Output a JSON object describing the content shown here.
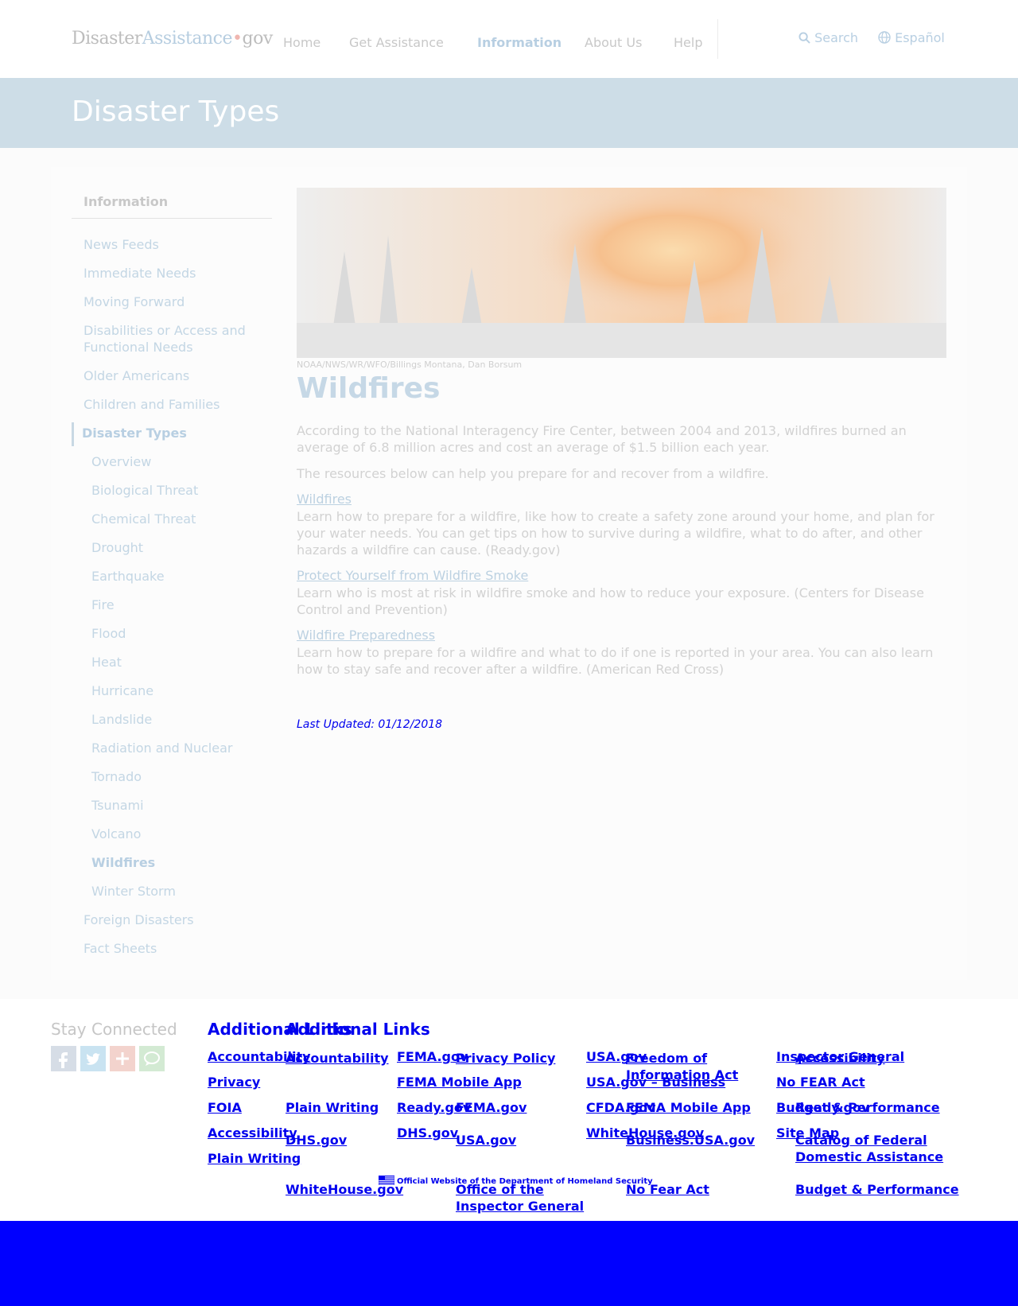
{
  "header": {
    "logo": {
      "part1": "Disaster",
      "part2": "Assistance",
      "dot": "•",
      "part3": "gov"
    },
    "nav": [
      {
        "label": "Home"
      },
      {
        "label": "Get Assistance"
      },
      {
        "label": "Information"
      },
      {
        "label": "About Us"
      },
      {
        "label": "Help"
      }
    ],
    "search_label": "Search",
    "language_label": "Español"
  },
  "banner": {
    "title": "Disaster Types"
  },
  "sidebar": {
    "heading": "Information",
    "items": [
      {
        "label": "News Feeds"
      },
      {
        "label": "Immediate Needs"
      },
      {
        "label": "Moving Forward"
      },
      {
        "label": "Disabilities or Access and Functional Needs"
      },
      {
        "label": "Older Americans"
      },
      {
        "label": "Children and Families"
      },
      {
        "label": "Disaster Types"
      }
    ],
    "subitems": [
      {
        "label": "Overview"
      },
      {
        "label": "Biological Threat"
      },
      {
        "label": "Chemical Threat"
      },
      {
        "label": "Drought"
      },
      {
        "label": "Earthquake"
      },
      {
        "label": "Fire"
      },
      {
        "label": "Flood"
      },
      {
        "label": "Heat"
      },
      {
        "label": "Hurricane"
      },
      {
        "label": "Landslide"
      },
      {
        "label": "Radiation and Nuclear"
      },
      {
        "label": "Tornado"
      },
      {
        "label": "Tsunami"
      },
      {
        "label": "Volcano"
      },
      {
        "label": "Wildfires"
      },
      {
        "label": "Winter Storm"
      }
    ],
    "after_items": [
      {
        "label": "Foreign Disasters"
      },
      {
        "label": "Fact Sheets"
      }
    ]
  },
  "main": {
    "image_credit": "NOAA/NWS/WR/WFO/Billings Montana, Dan Borsum",
    "title": "Wildfires",
    "intro": "According to the National Interagency Fire Center, between 2004 and 2013, wildfires burned an average of 6.8 million acres and cost an average of $1.5 billion each year.",
    "intro2": "The resources below can help you prepare for and recover from a wildfire.",
    "resources": [
      {
        "title": "Wildfires",
        "desc": "Learn how to prepare for a wildfire, like how to create a safety zone around your home, and plan for your water needs. You can get tips on how to survive during a wildfire, what to do after, and other hazards a wildfire can cause. (Ready.gov)"
      },
      {
        "title": "Protect Yourself from Wildfire Smoke",
        "desc": "Learn who is most at risk in wildfire smoke and how to reduce your exposure. (Centers for Disease Control and Prevention)"
      },
      {
        "title": "Wildfire Preparedness",
        "desc": "Learn how to prepare for a wildfire and what to do if one is reported in your area. You can also learn how to stay safe and recover after a wildfire. (American Red Cross)"
      }
    ],
    "last_updated": "Last Updated: 01/12/2018"
  },
  "footer": {
    "stay_connected": "Stay Connected",
    "social": [
      "facebook-icon",
      "twitter-icon",
      "google-plus-icon",
      "comment-icon"
    ],
    "heading_a": "Additional Links",
    "heading_b": "Additional Links",
    "links_a": {
      "col1": [
        "Accountability",
        "Privacy",
        "FOIA",
        "Accessibility",
        "Plain Writing"
      ],
      "col2": [
        "FEMA.gov",
        "FEMA Mobile App",
        "Ready.gov",
        "DHS.gov"
      ],
      "col3": [
        "USA.gov",
        "USA.gov – Business",
        "CFDA.gov",
        "WhiteHouse.gov"
      ],
      "col4": [
        "Inspector General",
        "No FEAR Act",
        "Budget & Performance",
        "Site Map"
      ]
    },
    "links_b": {
      "col1": [
        "Accountability",
        "Plain Writing",
        "DHS.gov",
        "WhiteHouse.gov"
      ],
      "col2": [
        "Privacy Policy",
        "FEMA.gov",
        "USA.gov",
        "Office of the Inspector General"
      ],
      "col3": [
        "Freedom of Information Act",
        "FEMA Mobile App",
        "Business.USA.gov",
        "No Fear Act"
      ],
      "col4": [
        "Accessibility",
        "Ready.gov",
        "Catalog of Federal Domestic Assistance",
        "Budget & Performance"
      ]
    },
    "official": "Official Website of the Department of Homeland Security"
  },
  "colors": {
    "banner": "#cddde7",
    "link_faded": "#c3d6e4",
    "footer_link": "#0000ee",
    "bottom_bar": "#0000ff"
  }
}
